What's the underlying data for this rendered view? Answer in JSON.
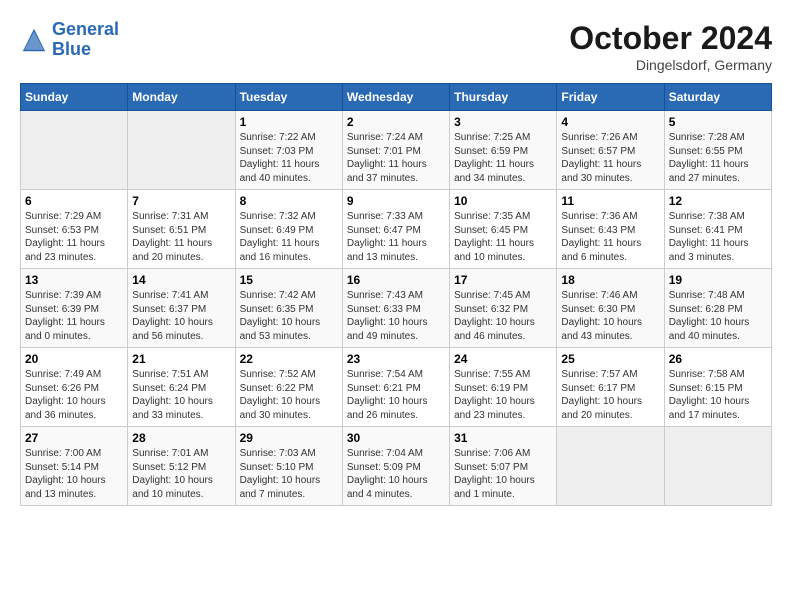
{
  "header": {
    "logo_line1": "General",
    "logo_line2": "Blue",
    "month": "October 2024",
    "location": "Dingelsdorf, Germany"
  },
  "weekdays": [
    "Sunday",
    "Monday",
    "Tuesday",
    "Wednesday",
    "Thursday",
    "Friday",
    "Saturday"
  ],
  "weeks": [
    [
      {
        "day": "",
        "empty": true
      },
      {
        "day": "",
        "empty": true
      },
      {
        "day": "1",
        "info": "Sunrise: 7:22 AM\nSunset: 7:03 PM\nDaylight: 11 hours and 40 minutes."
      },
      {
        "day": "2",
        "info": "Sunrise: 7:24 AM\nSunset: 7:01 PM\nDaylight: 11 hours and 37 minutes."
      },
      {
        "day": "3",
        "info": "Sunrise: 7:25 AM\nSunset: 6:59 PM\nDaylight: 11 hours and 34 minutes."
      },
      {
        "day": "4",
        "info": "Sunrise: 7:26 AM\nSunset: 6:57 PM\nDaylight: 11 hours and 30 minutes."
      },
      {
        "day": "5",
        "info": "Sunrise: 7:28 AM\nSunset: 6:55 PM\nDaylight: 11 hours and 27 minutes."
      }
    ],
    [
      {
        "day": "6",
        "info": "Sunrise: 7:29 AM\nSunset: 6:53 PM\nDaylight: 11 hours and 23 minutes."
      },
      {
        "day": "7",
        "info": "Sunrise: 7:31 AM\nSunset: 6:51 PM\nDaylight: 11 hours and 20 minutes."
      },
      {
        "day": "8",
        "info": "Sunrise: 7:32 AM\nSunset: 6:49 PM\nDaylight: 11 hours and 16 minutes."
      },
      {
        "day": "9",
        "info": "Sunrise: 7:33 AM\nSunset: 6:47 PM\nDaylight: 11 hours and 13 minutes."
      },
      {
        "day": "10",
        "info": "Sunrise: 7:35 AM\nSunset: 6:45 PM\nDaylight: 11 hours and 10 minutes."
      },
      {
        "day": "11",
        "info": "Sunrise: 7:36 AM\nSunset: 6:43 PM\nDaylight: 11 hours and 6 minutes."
      },
      {
        "day": "12",
        "info": "Sunrise: 7:38 AM\nSunset: 6:41 PM\nDaylight: 11 hours and 3 minutes."
      }
    ],
    [
      {
        "day": "13",
        "info": "Sunrise: 7:39 AM\nSunset: 6:39 PM\nDaylight: 11 hours and 0 minutes."
      },
      {
        "day": "14",
        "info": "Sunrise: 7:41 AM\nSunset: 6:37 PM\nDaylight: 10 hours and 56 minutes."
      },
      {
        "day": "15",
        "info": "Sunrise: 7:42 AM\nSunset: 6:35 PM\nDaylight: 10 hours and 53 minutes."
      },
      {
        "day": "16",
        "info": "Sunrise: 7:43 AM\nSunset: 6:33 PM\nDaylight: 10 hours and 49 minutes."
      },
      {
        "day": "17",
        "info": "Sunrise: 7:45 AM\nSunset: 6:32 PM\nDaylight: 10 hours and 46 minutes."
      },
      {
        "day": "18",
        "info": "Sunrise: 7:46 AM\nSunset: 6:30 PM\nDaylight: 10 hours and 43 minutes."
      },
      {
        "day": "19",
        "info": "Sunrise: 7:48 AM\nSunset: 6:28 PM\nDaylight: 10 hours and 40 minutes."
      }
    ],
    [
      {
        "day": "20",
        "info": "Sunrise: 7:49 AM\nSunset: 6:26 PM\nDaylight: 10 hours and 36 minutes."
      },
      {
        "day": "21",
        "info": "Sunrise: 7:51 AM\nSunset: 6:24 PM\nDaylight: 10 hours and 33 minutes."
      },
      {
        "day": "22",
        "info": "Sunrise: 7:52 AM\nSunset: 6:22 PM\nDaylight: 10 hours and 30 minutes."
      },
      {
        "day": "23",
        "info": "Sunrise: 7:54 AM\nSunset: 6:21 PM\nDaylight: 10 hours and 26 minutes."
      },
      {
        "day": "24",
        "info": "Sunrise: 7:55 AM\nSunset: 6:19 PM\nDaylight: 10 hours and 23 minutes."
      },
      {
        "day": "25",
        "info": "Sunrise: 7:57 AM\nSunset: 6:17 PM\nDaylight: 10 hours and 20 minutes."
      },
      {
        "day": "26",
        "info": "Sunrise: 7:58 AM\nSunset: 6:15 PM\nDaylight: 10 hours and 17 minutes."
      }
    ],
    [
      {
        "day": "27",
        "info": "Sunrise: 7:00 AM\nSunset: 5:14 PM\nDaylight: 10 hours and 13 minutes."
      },
      {
        "day": "28",
        "info": "Sunrise: 7:01 AM\nSunset: 5:12 PM\nDaylight: 10 hours and 10 minutes."
      },
      {
        "day": "29",
        "info": "Sunrise: 7:03 AM\nSunset: 5:10 PM\nDaylight: 10 hours and 7 minutes."
      },
      {
        "day": "30",
        "info": "Sunrise: 7:04 AM\nSunset: 5:09 PM\nDaylight: 10 hours and 4 minutes."
      },
      {
        "day": "31",
        "info": "Sunrise: 7:06 AM\nSunset: 5:07 PM\nDaylight: 10 hours and 1 minute."
      },
      {
        "day": "",
        "empty": true
      },
      {
        "day": "",
        "empty": true
      }
    ]
  ]
}
